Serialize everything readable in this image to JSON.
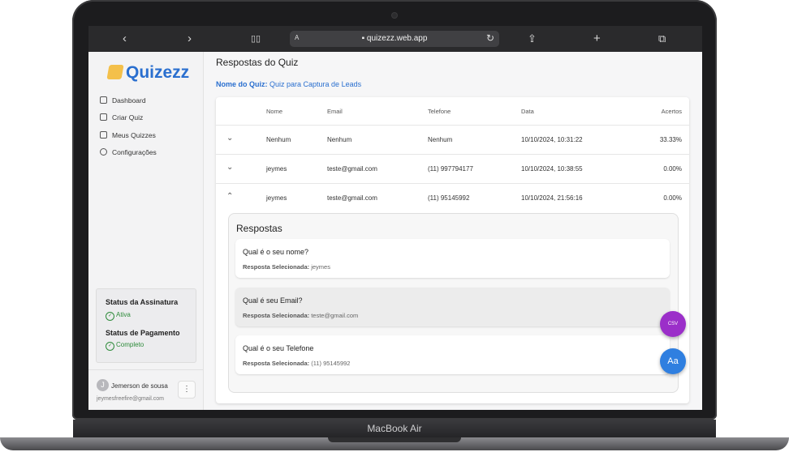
{
  "device": {
    "model_label": "MacBook Air"
  },
  "browser": {
    "back_icon": "‹",
    "forward_icon": "›",
    "reader_label": "A",
    "url": "quizezz.web.app",
    "lock": "🔒",
    "reload_icon": "↻",
    "share_icon": "⇪",
    "newtab_icon": "+",
    "tabs_icon": "⧉",
    "bookmarks_icon": "📖"
  },
  "sidebar": {
    "logo": "Quizezz",
    "items": [
      {
        "label": "Dashboard",
        "icon": "home-icon"
      },
      {
        "label": "Criar Quiz",
        "icon": "edit-icon"
      },
      {
        "label": "Meus Quizzes",
        "icon": "list-icon"
      },
      {
        "label": "Configurações",
        "icon": "gear-icon"
      }
    ],
    "status": {
      "subscription_title": "Status da Assinatura",
      "subscription_value": "Ativa",
      "payment_title": "Status de Pagamento",
      "payment_value": "Completo"
    },
    "user": {
      "initial": "J",
      "name": "Jemerson de sousa",
      "email": "jeymesfreefire@gmail.com",
      "menu": "⋮"
    }
  },
  "main": {
    "title": "Respostas do Quiz",
    "quiz_label": "Nome do Quiz:",
    "quiz_name": "Quiz para Captura de Leads",
    "columns": [
      "Nome",
      "Email",
      "Telefone",
      "Data",
      "Acertos"
    ],
    "rows": [
      {
        "chevron": "⌄",
        "nome": "Nenhum",
        "email": "Nenhum",
        "telefone": "Nenhum",
        "data": "10/10/2024, 10:31:22",
        "acertos": "33.33%"
      },
      {
        "chevron": "⌄",
        "nome": "jeymes",
        "email": "teste@gmail.com",
        "telefone": "(11) 997794177",
        "data": "10/10/2024, 10:38:55",
        "acertos": "0.00%"
      },
      {
        "chevron": "⌃",
        "nome": "jeymes",
        "email": "teste@gmail.com",
        "telefone": "(11) 95145992",
        "data": "10/10/2024, 21:56:16",
        "acertos": "0.00%"
      }
    ],
    "answers": {
      "title": "Respostas",
      "selected_label": "Resposta Selecionada:",
      "items": [
        {
          "question": "Qual é o seu nome?",
          "answer": "jeymes"
        },
        {
          "question": "Qual é seu Email?",
          "answer": "teste@gmail.com"
        },
        {
          "question": "Qual é o seu Telefone",
          "answer": "(11) 95145992"
        }
      ]
    },
    "fab_csv": "CSV",
    "fab_font": "Aa"
  },
  "colors": {
    "accent": "#2a6fcf",
    "purple": "#9b2fc9",
    "blue_fab": "#2f7fe0",
    "success": "#2e8b3a"
  }
}
